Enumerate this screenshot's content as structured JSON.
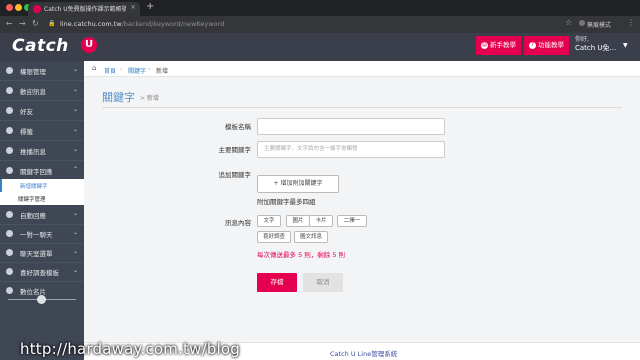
{
  "browser": {
    "tab_title": "Catch U免費版操作課示範帳號",
    "tab_close": "×",
    "new_tab": "+",
    "url_host": "line.catchu.com.tw",
    "url_path": "/backend/keyword/newKeyword",
    "incognito_label": "無痕模式",
    "colors": {
      "close": "#ff5f57",
      "minimize": "#febc2e",
      "maximize": "#28c840"
    }
  },
  "header": {
    "logo": "Catch",
    "logo_badge": "U",
    "btn_beginner": "新手教學",
    "btn_feature": "功能教學",
    "greeting": "你好,",
    "user_name": "Catch U免...",
    "accent": "#e5004f"
  },
  "sidebar": {
    "items": [
      {
        "label": "權限管理",
        "icon": "dashboard-icon"
      },
      {
        "label": "歡迎訊息",
        "icon": "smile-icon"
      },
      {
        "label": "好友",
        "icon": "users-icon"
      },
      {
        "label": "標籤",
        "icon": "tag-icon"
      },
      {
        "label": "推播訊息",
        "icon": "broadcast-icon"
      },
      {
        "label": "關鍵字回應",
        "icon": "keyword-icon"
      }
    ],
    "subitems": [
      {
        "label": "新增關鍵字"
      },
      {
        "label": "關鍵字管理"
      }
    ],
    "items2": [
      {
        "label": "自動回應",
        "icon": "autoreply-icon"
      },
      {
        "label": "一對一聊天",
        "icon": "chat-icon"
      },
      {
        "label": "聊天室選單",
        "icon": "menu-icon"
      },
      {
        "label": "喜好調查模板",
        "icon": "survey-icon"
      },
      {
        "label": "數位名片",
        "icon": "card-icon"
      }
    ]
  },
  "breadcrumb": {
    "home": "首頁",
    "section": "關鍵字",
    "current": "新增",
    "sep": "›"
  },
  "page": {
    "title": "關鍵字",
    "subtitle": "> 新增"
  },
  "form": {
    "template_label": "模板名稱",
    "main_keyword_label": "主要關鍵字",
    "main_keyword_placeholder": "主要關鍵字，文字請勿含一樣字會觸發",
    "additional_label": "追加關鍵字",
    "add_button": "增加附加關鍵字",
    "add_hint": "附加關鍵字最多四組",
    "content_label": "訊息內容",
    "message_types": [
      "文字",
      "圖片",
      "卡片",
      "二擇一",
      "喜好調查",
      "圖文訊息"
    ],
    "warning": "每次傳送最多 5 則，剩餘 5 則",
    "save": "存檔",
    "cancel": "取消"
  },
  "footer": {
    "text": "Catch U Line管理系統"
  },
  "watermark": "http://hardaway.com.tw/blog"
}
